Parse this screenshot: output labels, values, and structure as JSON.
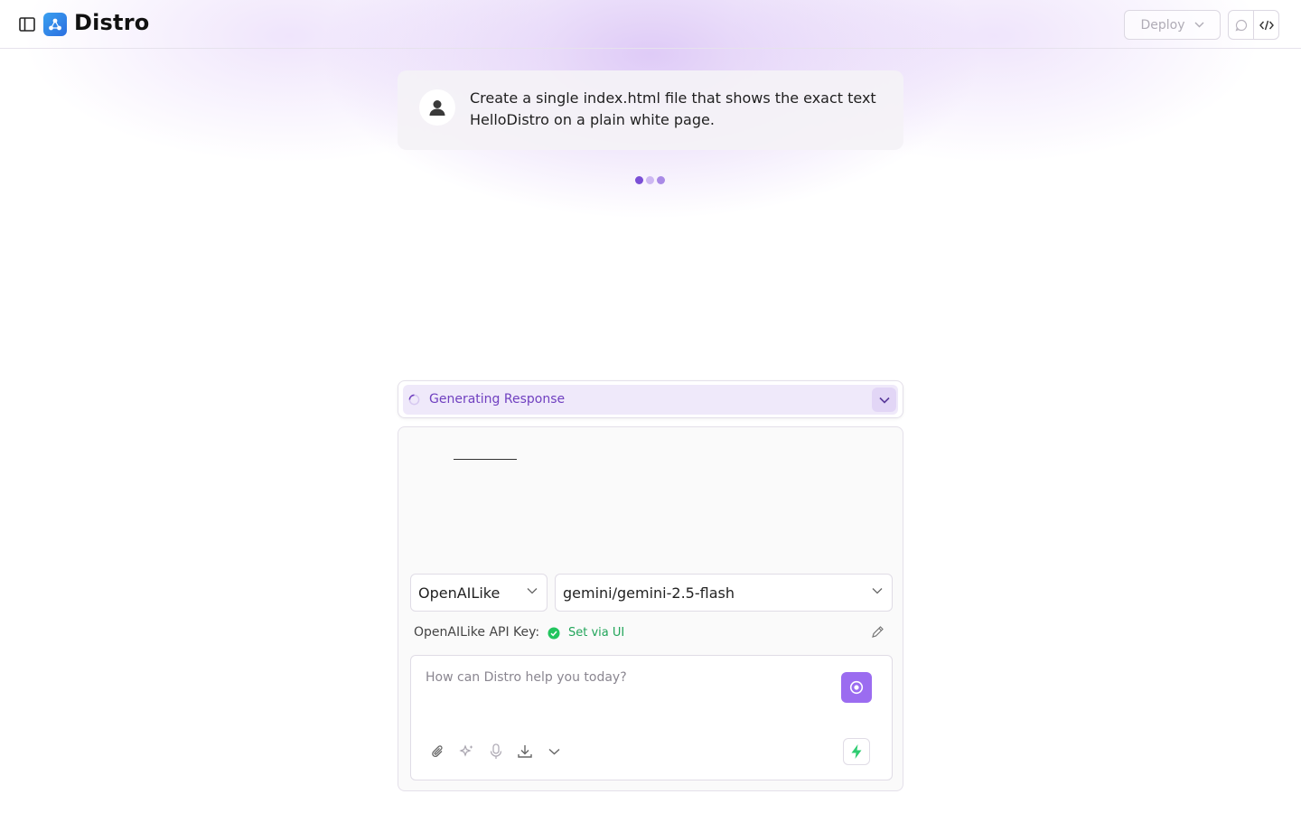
{
  "header": {
    "brand": "Distro",
    "deploy_label": "Deploy"
  },
  "conversation": {
    "user_message": "Create a single index.html file that shows the exact text HelloDistro on a plain white page."
  },
  "status": {
    "generating_label": "Generating Response"
  },
  "composer": {
    "provider": "OpenAILike",
    "model": "gemini/gemini-2.5-flash",
    "api_key_label": "OpenAILike API Key:",
    "api_key_status": "Set via UI",
    "placeholder": "How can Distro help you today?"
  },
  "icons": {
    "sidebar_toggle": "sidebar-icon",
    "logo": "distro-logo-icon",
    "chat_header": "chat-icon",
    "code": "code-icon",
    "avatar": "user-avatar-icon",
    "attach": "paperclip-icon",
    "enhance": "sparkles-icon",
    "mic": "microphone-icon",
    "import": "download-icon",
    "more": "chevron-down-icon",
    "stop": "stop-icon",
    "bolt": "lightning-icon"
  },
  "colors": {
    "accent": "#9b6cf0",
    "status_text": "#7040c0",
    "success": "#22a55a",
    "lightning": "#2ecc71"
  }
}
